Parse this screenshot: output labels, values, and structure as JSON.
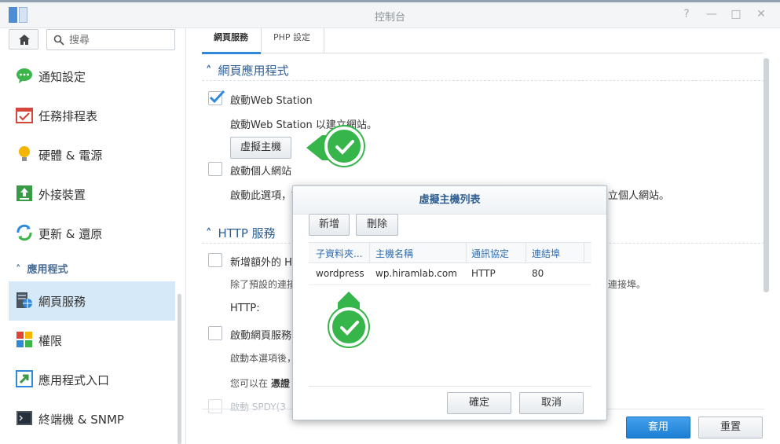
{
  "window": {
    "title": "控制台",
    "controls": [
      "help-icon",
      "maximize-icon",
      "minimize-icon",
      "close-icon"
    ]
  },
  "sidebar": {
    "search_placeholder": "搜尋",
    "items": [
      {
        "label": "通知設定",
        "icon": "notification-icon"
      },
      {
        "label": "任務排程表",
        "icon": "task-scheduler-icon"
      },
      {
        "label": "硬體 & 電源",
        "icon": "hardware-power-icon"
      },
      {
        "label": "外接裝置",
        "icon": "external-device-icon"
      },
      {
        "label": "更新 & 還原",
        "icon": "update-restore-icon"
      }
    ],
    "category": "應用程式",
    "app_items": [
      {
        "label": "網頁服務",
        "icon": "web-services-icon",
        "active": true
      },
      {
        "label": "權限",
        "icon": "privileges-icon"
      },
      {
        "label": "應用程式入口",
        "icon": "application-portal-icon"
      },
      {
        "label": "終端機 & SNMP",
        "icon": "terminal-snmp-icon"
      }
    ]
  },
  "main": {
    "tabs": [
      {
        "label": "網頁服務",
        "active": true
      },
      {
        "label": "PHP 設定",
        "active": false
      }
    ],
    "web_app_section": {
      "title": "網頁應用程式",
      "enable_web_station": {
        "label": "啟動Web Station",
        "checked": true
      },
      "web_station_hint": "啟動Web Station 以建立網站。",
      "virtual_host_button": "虛擬主機",
      "enable_personal": {
        "label": "啟動個人網站",
        "checked": false
      },
      "personal_hint_start": "啟動此選項，讀",
      "personal_hint_end": "立個人網站。"
    },
    "http_section": {
      "title": "HTTP 服務",
      "extra_port": {
        "label": "新增額外的 HT",
        "checked": false
      },
      "extra_port_hint_start": "除了預設的連接",
      "extra_port_hint_end": "連接埠。",
      "http_label": "HTTP:",
      "enable_service": {
        "label": "啟動網頁服務的",
        "checked": false
      },
      "service_hint": "啟動本選項後，",
      "service_hint2_start": "您可以在",
      "service_hint2_bold": "憑證",
      "partial_row": "啟動 SPDY(3"
    },
    "footer": {
      "apply": "套用",
      "reset": "重置"
    }
  },
  "dialog": {
    "title": "虛擬主機列表",
    "add_button": "新增",
    "delete_button": "刪除",
    "columns": [
      "子資料夾...",
      "主機名稱",
      "通訊協定",
      "連結埠"
    ],
    "rows": [
      [
        "wordpress",
        "wp.hiramlab.com",
        "HTTP",
        "80"
      ]
    ],
    "ok_button": "確定",
    "cancel_button": "取消"
  },
  "colors": {
    "accent": "#2f88dc",
    "section_title": "#2e5e93",
    "badge_green": "#35b54a",
    "sidebar_active": "#d6e9f8"
  }
}
